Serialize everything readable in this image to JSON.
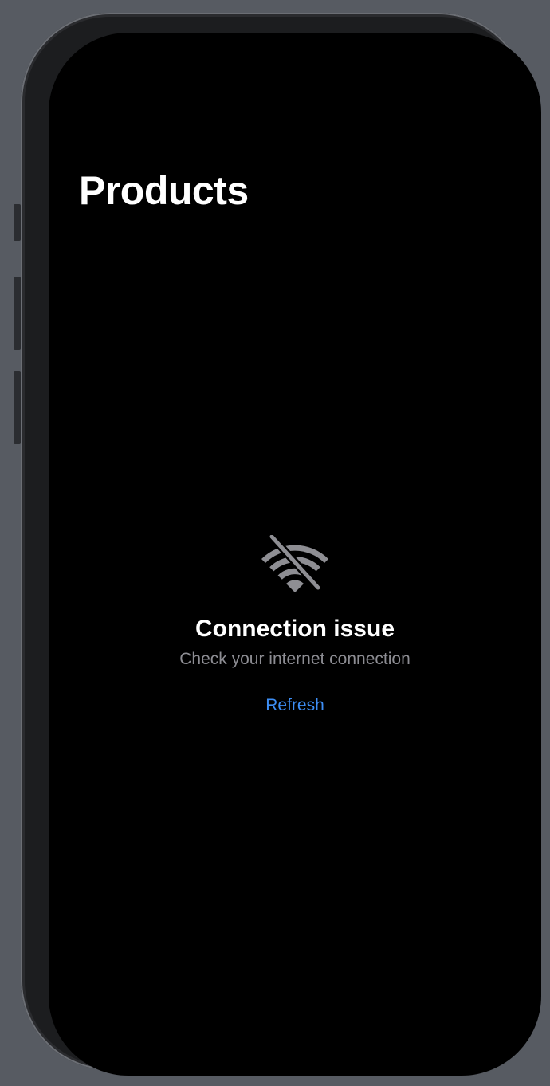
{
  "navigation": {
    "title": "Products"
  },
  "empty_state": {
    "icon": "wifi-slash-icon",
    "title": "Connection issue",
    "subtitle": "Check your internet connection",
    "action_label": "Refresh"
  },
  "colors": {
    "background": "#000000",
    "title": "#ffffff",
    "subtitle": "#8d8d93",
    "icon": "#8e8e93",
    "accent": "#3d8ef5",
    "bezel": "#1c1d1f",
    "canvas": "#575b62"
  }
}
